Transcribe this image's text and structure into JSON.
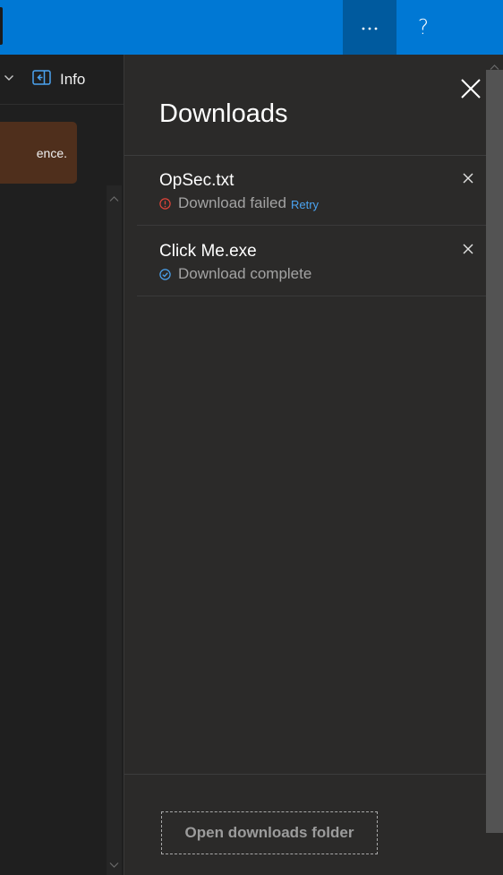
{
  "topbar": {
    "more_icon": "ellipsis-icon",
    "help_icon": "question-mark-icon",
    "help_label": "?",
    "accent_color": "#0078d4",
    "active_color": "#005a9e"
  },
  "leftpane": {
    "chevron_icon": "chevron-down-icon",
    "info_icon": "panel-info-icon",
    "info_label": "Info",
    "notice_text": "ence.",
    "notice_color": "#4f2f1c"
  },
  "downloads": {
    "title": "Downloads",
    "close_icon": "close-icon",
    "items": [
      {
        "name": "OpSec.txt",
        "status": "Download failed",
        "status_icon": "error-circle-icon",
        "status_color": "#e0443a",
        "action": "Retry",
        "remove_icon": "close-icon"
      },
      {
        "name": "Click Me.exe",
        "status": "Download complete",
        "status_icon": "checkmark-circle-icon",
        "status_color": "#4ba3f0",
        "remove_icon": "close-icon"
      }
    ],
    "open_folder_label": "Open downloads folder"
  }
}
